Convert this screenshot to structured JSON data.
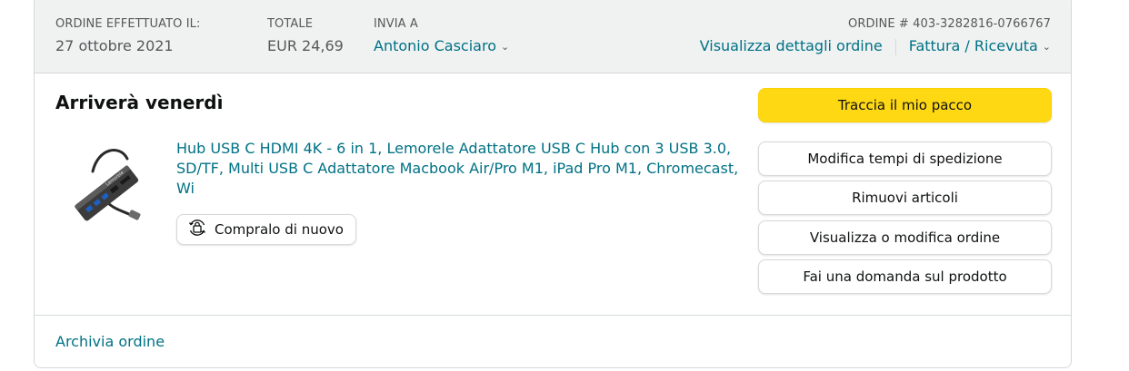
{
  "order": {
    "placed_label": "ORDINE EFFETTUATO IL:",
    "placed_date": "27 ottobre 2021",
    "total_label": "TOTALE",
    "total_value": "EUR 24,69",
    "ship_label": "INVIA A",
    "ship_name": "Antonio Casciaro",
    "order_number": "ORDINE # 403-3282816-0766767",
    "details_link": "Visualizza dettagli ordine",
    "invoice_link": "Fattura / Ricevuta"
  },
  "shipment": {
    "status_title": "Arriverà venerdì"
  },
  "product": {
    "title": "Hub USB C HDMI 4K - 6 in 1, Lemorele Adattatore USB C Hub con 3 USB 3.0, SD/TF, Multi USB C Adattatore Macbook Air/Pro M1, iPad Pro M1, Chromecast, Wi",
    "buy_again_label": "Compralo di nuovo",
    "buy_again_icon": "buy-again-icon",
    "image_label": "Lemorele"
  },
  "actions": {
    "track": "Traccia il mio pacco",
    "change_shipping": "Modifica tempi di spedizione",
    "remove_items": "Rimuovi articoli",
    "view_edit": "Visualizza o modifica ordine",
    "ask_question": "Fai una domanda sul prodotto"
  },
  "footer": {
    "archive": "Archivia ordine"
  },
  "colors": {
    "link": "#007185",
    "primary_button": "#ffd814",
    "header_bg": "#f0f2f2",
    "border": "#d5d9d9"
  }
}
